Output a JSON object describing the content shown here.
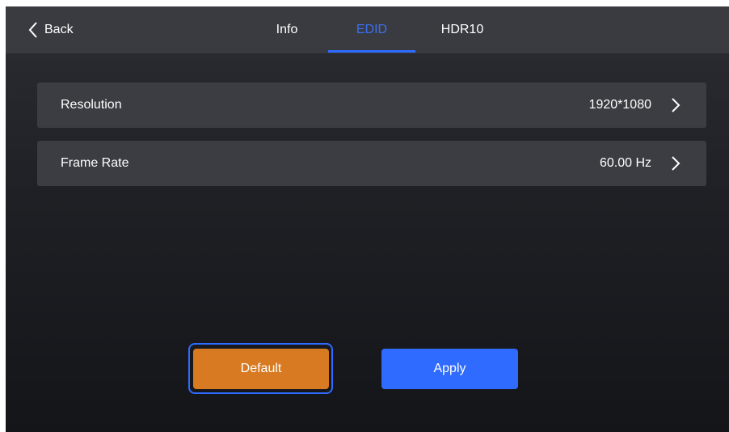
{
  "header": {
    "back_label": "Back",
    "tabs": [
      {
        "label": "Info",
        "active": false
      },
      {
        "label": "EDID",
        "active": true
      },
      {
        "label": "HDR10",
        "active": false
      }
    ]
  },
  "settings": [
    {
      "label": "Resolution",
      "value": "1920*1080"
    },
    {
      "label": "Frame Rate",
      "value": "60.00 Hz"
    }
  ],
  "actions": {
    "default_label": "Default",
    "apply_label": "Apply"
  },
  "colors": {
    "accent": "#2f6bff",
    "default_button": "#d77a22",
    "row_background": "#3b3d42",
    "topbar_background": "#3a3b40"
  },
  "icons": {
    "back": "chevron-left-icon",
    "row_arrow": "chevron-right-icon"
  }
}
